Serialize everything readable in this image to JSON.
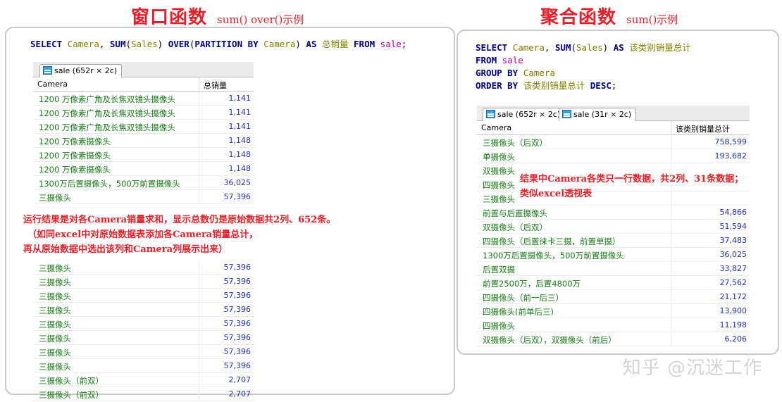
{
  "left": {
    "heading": "窗口函数",
    "subheading": "sum() over()示例",
    "sql_lines": [
      [
        [
          "kw",
          "SELECT "
        ],
        [
          "id",
          "Camera"
        ],
        [
          "tx",
          ", "
        ],
        [
          "kw",
          "SUM"
        ],
        [
          "tx",
          "("
        ],
        [
          "id",
          "Sales"
        ],
        [
          "tx",
          ") "
        ],
        [
          "kw",
          "OVER"
        ],
        [
          "tx",
          "("
        ],
        [
          "kw",
          "PARTITION BY "
        ],
        [
          "id",
          "Camera"
        ],
        [
          "tx",
          ") "
        ],
        [
          "kw",
          "AS "
        ],
        [
          "cn",
          "总销量 "
        ],
        [
          "kw",
          "FROM "
        ],
        [
          "tb",
          "sale"
        ],
        [
          "tx",
          ";"
        ]
      ]
    ],
    "tab_label": "sale (652r × 2c)",
    "col_headers": [
      "Camera",
      "总销量"
    ],
    "rows_top": [
      [
        "1200 万像素广角及长焦双镜头摄像头",
        "1,141"
      ],
      [
        "1200 万像素广角及长焦双镜头摄像头",
        "1,141"
      ],
      [
        "1200 万像素广角及长焦双镜头摄像头",
        "1,141"
      ],
      [
        "1200 万像素摄像头",
        "1,148"
      ],
      [
        "1200 万像素摄像头",
        "1,148"
      ],
      [
        "1200 万像素摄像头",
        "1,148"
      ],
      [
        "1300万后置摄像头，500万前置摄像头",
        "36,025"
      ],
      [
        "三摄像头",
        "57,396"
      ]
    ],
    "rows_bottom": [
      [
        "三摄像头",
        "57,396"
      ],
      [
        "三摄像头",
        "57,396"
      ],
      [
        "三摄像头",
        "57,396"
      ],
      [
        "三摄像头",
        "57,396"
      ],
      [
        "三摄像头",
        "57,396"
      ],
      [
        "三摄像头",
        "57,396"
      ],
      [
        "三摄像头",
        "57,396"
      ],
      [
        "三摄像头",
        "57,396"
      ],
      [
        "三摄像头（前双）",
        "2,707"
      ],
      [
        "三摄像头（前双）",
        "2,707"
      ]
    ],
    "annotation": [
      "运行结果是对各Camera销量求和，显示总数仍是原始数据共2列、652条。",
      "（如同excel中对原始数据表添加各Camera销量总计，",
      "再从原始数据中选出该列和Camera列展示出来）"
    ]
  },
  "right": {
    "heading": "聚合函数",
    "subheading": "sum()示例",
    "sql_lines": [
      [
        [
          "kw",
          "SELECT "
        ],
        [
          "id",
          "Camera"
        ],
        [
          "tx",
          ", "
        ],
        [
          "kw",
          "SUM"
        ],
        [
          "tx",
          "("
        ],
        [
          "id",
          "Sales"
        ],
        [
          "tx",
          ") "
        ],
        [
          "kw",
          "AS "
        ],
        [
          "cn",
          "该类别销量总计"
        ]
      ],
      [
        [
          "kw",
          "FROM "
        ],
        [
          "tb",
          "sale"
        ]
      ],
      [
        [
          "kw",
          "GROUP BY "
        ],
        [
          "id",
          "Camera"
        ]
      ],
      [
        [
          "kw",
          "ORDER BY "
        ],
        [
          "cn",
          "该类别销量总计 "
        ],
        [
          "kw",
          "DESC"
        ],
        [
          "tx",
          ";"
        ]
      ]
    ],
    "tab1_label": "sale (652r × 2c)",
    "tab2_label": "sale (31r × 2c)",
    "col_headers": [
      "Camera",
      "该类别销量总计"
    ],
    "rows": [
      [
        "三摄像头（后双）",
        "758,599"
      ],
      [
        "单摄像头",
        "193,682"
      ],
      [
        "双摄像头",
        ""
      ],
      [
        "四摄像头",
        ""
      ],
      [
        "三摄像头",
        ""
      ],
      [
        "前置与后置摄像头",
        "54,866"
      ],
      [
        "双摄像头（后双）",
        "51,594"
      ],
      [
        "四摄像头（后置徕卡三摄，前置单摄）",
        "37,483"
      ],
      [
        "1300万后置摄像头，500万前置摄像头",
        "36,025"
      ],
      [
        "后置双摄",
        "33,827"
      ],
      [
        "前置2500万，后置4800万",
        "27,562"
      ],
      [
        "四摄像头（前一后三）",
        "21,172"
      ],
      [
        "四摄像头(前单后三)",
        "13,900"
      ],
      [
        "四摄像头",
        "11,198"
      ],
      [
        "双摄像头（后双），双摄像头（前后）",
        "6,206"
      ]
    ],
    "annotation": [
      "结果中Camera各类只一行数据，共2列、31条数据；",
      "类似excel透视表"
    ]
  },
  "watermark": "知乎 @沉迷工作"
}
